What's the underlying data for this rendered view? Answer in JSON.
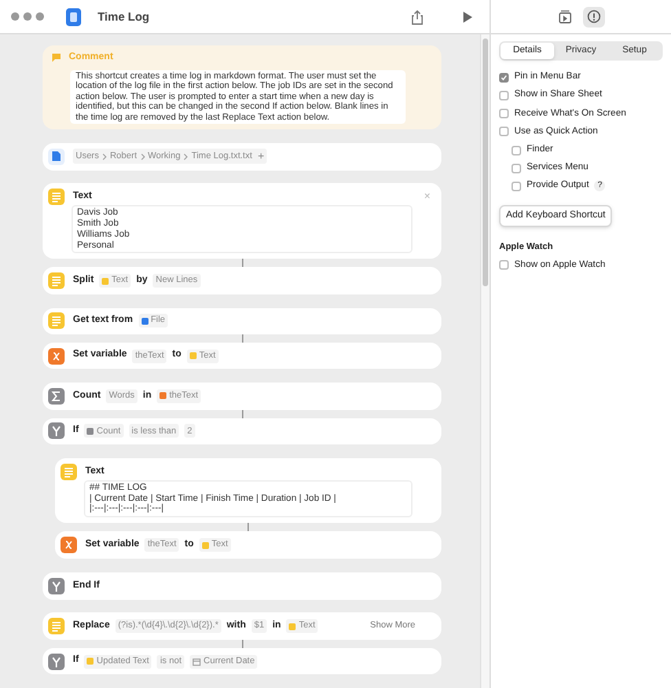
{
  "window": {
    "title": "Time Log"
  },
  "actions": [
    {
      "kind": "comment",
      "title": "Comment",
      "body": "This shortcut creates a time log in markdown format. The user must set the location of the log file in the first action below. The job IDs are set in the second action below. The user is prompted to enter a start time when a new day is identified, but this can be changed in the second If action below. Blank lines in the time log are removed by the last Replace Text action below.",
      "linked": false
    },
    {
      "kind": "path",
      "path": [
        "Users",
        "Robert",
        "Working",
        "Time Log.txt.txt"
      ],
      "add": "+",
      "linked": false
    },
    {
      "kind": "text-block",
      "title": "Text",
      "close": "×",
      "lines": [
        "Davis Job",
        "Smith Job",
        "Williams Job",
        "Personal"
      ],
      "linked": true
    },
    {
      "kind": "text-action",
      "parts": [
        {
          "kind": "word",
          "text": "Split"
        },
        {
          "kind": "text-token",
          "text": "Text"
        },
        {
          "kind": "word",
          "text": "by"
        },
        {
          "kind": "plain-token",
          "text": "New Lines"
        }
      ],
      "linked": false
    },
    {
      "kind": "text-action",
      "parts": [
        {
          "kind": "word",
          "text": "Get text from"
        },
        {
          "kind": "file-token",
          "text": "File"
        }
      ],
      "linked": true
    },
    {
      "kind": "variable-action",
      "parts": [
        {
          "kind": "word",
          "text": "Set variable"
        },
        {
          "kind": "plain-token",
          "text": "theText"
        },
        {
          "kind": "word",
          "text": "to"
        },
        {
          "kind": "text-token",
          "text": "Text"
        }
      ],
      "linked": false
    },
    {
      "kind": "count-action",
      "parts": [
        {
          "kind": "word",
          "text": "Count"
        },
        {
          "kind": "plain-token",
          "text": "Words"
        },
        {
          "kind": "word",
          "text": "in"
        },
        {
          "kind": "variable-token",
          "text": "theText"
        }
      ],
      "linked": true
    },
    {
      "kind": "if-action",
      "parts": [
        {
          "kind": "word",
          "text": "If"
        },
        {
          "kind": "count-token",
          "text": "Count"
        },
        {
          "kind": "plain-token",
          "text": "is less than"
        },
        {
          "kind": "plain-token",
          "text": "2"
        }
      ],
      "linked": false,
      "children": [
        {
          "kind": "text-block",
          "title": "Text",
          "lines": [
            "## TIME LOG",
            "| Current Date | Start Time | Finish Time | Duration | Job ID |",
            "|:---|:---|:---|:---|:---|"
          ],
          "linked": true
        },
        {
          "kind": "variable-action",
          "parts": [
            {
              "kind": "word",
              "text": "Set variable"
            },
            {
              "kind": "plain-token",
              "text": "theText"
            },
            {
              "kind": "word",
              "text": "to"
            },
            {
              "kind": "text-token",
              "text": "Text"
            }
          ],
          "linked": false
        }
      ]
    },
    {
      "kind": "if-action",
      "parts": [
        {
          "kind": "word",
          "text": "End If"
        }
      ],
      "linked": false
    },
    {
      "kind": "text-action",
      "parts": [
        {
          "kind": "word",
          "text": "Replace"
        },
        {
          "kind": "plain-token",
          "text": "(?is).*(\\d{4}\\.\\d{2}\\.\\d{2}).*"
        },
        {
          "kind": "word",
          "text": "with"
        },
        {
          "kind": "plain-token",
          "text": "$1"
        },
        {
          "kind": "word",
          "text": "in"
        },
        {
          "kind": "text-token",
          "text": "Text"
        }
      ],
      "more": "Show More",
      "linked": true
    },
    {
      "kind": "if-action",
      "parts": [
        {
          "kind": "word",
          "text": "If"
        },
        {
          "kind": "text-token",
          "text": "Updated Text"
        },
        {
          "kind": "plain-token",
          "text": "is not"
        },
        {
          "kind": "date-token",
          "text": "Current Date"
        }
      ],
      "linked": false
    }
  ],
  "sidebar": {
    "tabs": [
      {
        "label": "Details",
        "selected": true
      },
      {
        "label": "Privacy",
        "selected": false
      },
      {
        "label": "Setup",
        "selected": false
      }
    ],
    "options": [
      {
        "label": "Pin in Menu Bar",
        "checked": true
      },
      {
        "label": "Show in Share Sheet",
        "checked": false
      },
      {
        "label": "Receive What's On Screen",
        "checked": false
      },
      {
        "label": "Use as Quick Action",
        "checked": false,
        "children": [
          {
            "label": "Finder",
            "checked": false
          },
          {
            "label": "Services Menu",
            "checked": false
          },
          {
            "label": "Provide Output",
            "checked": false,
            "help": "?"
          }
        ]
      }
    ],
    "shortcut_button": "Add Keyboard Shortcut",
    "watch": {
      "heading": "Apple Watch",
      "options": [
        {
          "label": "Show on Apple Watch",
          "checked": false
        }
      ]
    }
  }
}
